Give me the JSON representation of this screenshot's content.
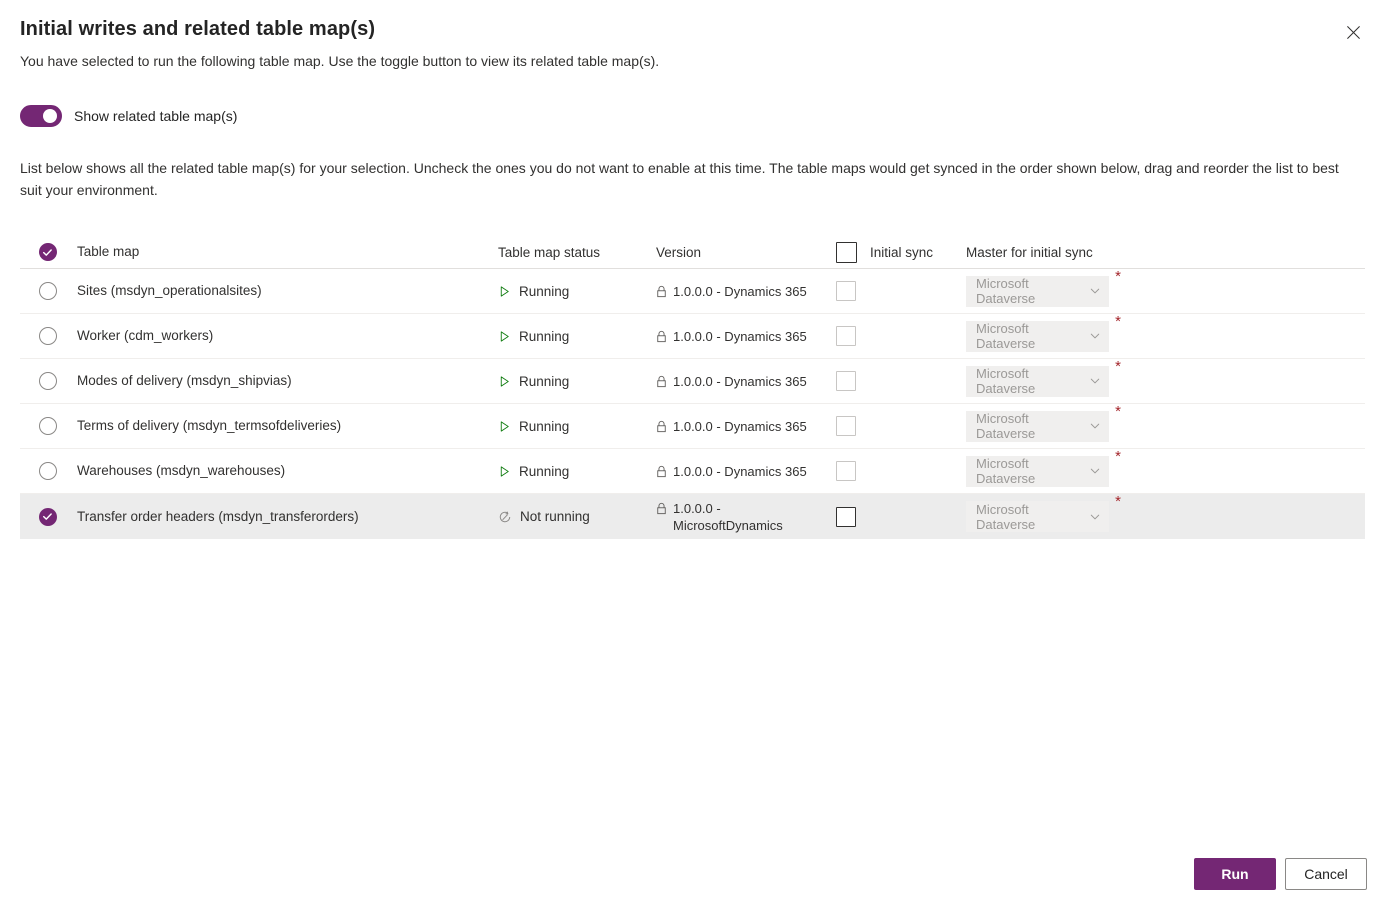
{
  "dialog": {
    "title": "Initial writes and related table map(s)",
    "subtitle": "You have selected to run the following table map. Use the toggle button to view its related table map(s).",
    "close_label": "Close",
    "toggle_label": "Show related table map(s)",
    "toggle_on": true,
    "description": "List below shows all the related table map(s) for your selection. Uncheck the ones you do not want to enable at this time. The table maps would get synced in the order shown below, drag and reorder the list to best suit your environment."
  },
  "colors": {
    "accent": "#742774",
    "status_running": "#107c10",
    "status_not_running": "#8a8886",
    "required_star": "#a4262c",
    "selected_row": "#ececec"
  },
  "table": {
    "headers": {
      "table_map": "Table map",
      "status": "Table map status",
      "version": "Version",
      "initial_sync": "Initial sync",
      "master": "Master for initial sync"
    },
    "header_select_all_checked": true,
    "header_initial_sync_checked": false,
    "rows": [
      {
        "name": "Sites (msdyn_operationalsites)",
        "status": "Running",
        "status_icon": "play-icon",
        "version": "1.0.0.0 - Dynamics 365",
        "selected": false,
        "initial_sync": false,
        "master": "Microsoft Dataverse",
        "master_required": true,
        "highlighted": false
      },
      {
        "name": "Worker (cdm_workers)",
        "status": "Running",
        "status_icon": "play-icon",
        "version": "1.0.0.0 - Dynamics 365",
        "selected": false,
        "initial_sync": false,
        "master": "Microsoft Dataverse",
        "master_required": true,
        "highlighted": false
      },
      {
        "name": "Modes of delivery (msdyn_shipvias)",
        "status": "Running",
        "status_icon": "play-icon",
        "version": "1.0.0.0 - Dynamics 365",
        "selected": false,
        "initial_sync": false,
        "master": "Microsoft Dataverse",
        "master_required": true,
        "highlighted": false
      },
      {
        "name": "Terms of delivery (msdyn_termsofdeliveries)",
        "status": "Running",
        "status_icon": "play-icon",
        "version": "1.0.0.0 - Dynamics 365",
        "selected": false,
        "initial_sync": false,
        "master": "Microsoft Dataverse",
        "master_required": true,
        "highlighted": false
      },
      {
        "name": "Warehouses (msdyn_warehouses)",
        "status": "Running",
        "status_icon": "play-icon",
        "version": "1.0.0.0 - Dynamics 365",
        "selected": false,
        "initial_sync": false,
        "master": "Microsoft Dataverse",
        "master_required": true,
        "highlighted": false
      },
      {
        "name": "Transfer order headers (msdyn_transferorders)",
        "status": "Not running",
        "status_icon": "not-running-icon",
        "version": "1.0.0.0 - MicrosoftDynamics",
        "selected": true,
        "initial_sync": false,
        "master": "Microsoft Dataverse",
        "master_required": true,
        "highlighted": true
      }
    ]
  },
  "footer": {
    "run_label": "Run",
    "cancel_label": "Cancel"
  }
}
